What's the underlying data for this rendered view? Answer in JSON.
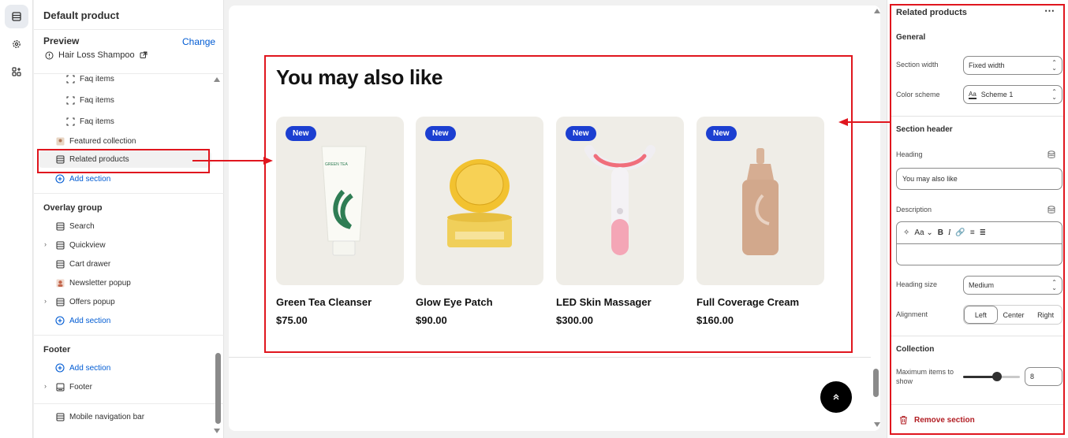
{
  "sidebar": {
    "title": "Default product",
    "preview_label": "Preview",
    "change_link": "Change",
    "preview_item": "Hair Loss Shampoo",
    "rows": [
      {
        "label": "Faq items"
      },
      {
        "label": "Faq items"
      },
      {
        "label": "Faq items"
      },
      {
        "label": "Featured collection"
      },
      {
        "label": "Related products"
      },
      {
        "label": "Add section"
      }
    ],
    "overlay_group": {
      "title": "Overlay group",
      "items": [
        {
          "label": "Search"
        },
        {
          "label": "Quickview"
        },
        {
          "label": "Cart drawer"
        },
        {
          "label": "Newsletter popup"
        },
        {
          "label": "Offers popup"
        },
        {
          "label": "Add section"
        }
      ]
    },
    "footer_group": {
      "title": "Footer",
      "items": [
        {
          "label": "Add section"
        },
        {
          "label": "Footer"
        }
      ]
    },
    "mobile_nav": "Mobile navigation bar"
  },
  "canvas": {
    "heading": "You may also like",
    "products": [
      {
        "badge": "New",
        "title": "Green Tea Cleanser",
        "price": "$75.00"
      },
      {
        "badge": "New",
        "title": "Glow Eye Patch",
        "price": "$90.00"
      },
      {
        "badge": "New",
        "title": "LED Skin Massager",
        "price": "$300.00"
      },
      {
        "badge": "New",
        "title": "Full Coverage Cream",
        "price": "$160.00"
      }
    ]
  },
  "panel": {
    "title": "Related products",
    "general": "General",
    "section_width_label": "Section width",
    "section_width_value": "Fixed width",
    "color_scheme_label": "Color scheme",
    "color_scheme_value": "Scheme 1",
    "color_scheme_swatch": "Aa",
    "section_header": "Section header",
    "heading_label": "Heading",
    "heading_value": "You may also like",
    "description_label": "Description",
    "rte_font": "Aa",
    "heading_size_label": "Heading size",
    "heading_size_value": "Medium",
    "alignment_label": "Alignment",
    "alignment_options": [
      "Left",
      "Center",
      "Right"
    ],
    "collection": "Collection",
    "max_items_label": "Maximum items to show",
    "max_items_value": 8,
    "max_items_range": [
      2,
      12
    ],
    "max_items_text": "8",
    "remove_section": "Remove section"
  },
  "colors": {
    "accent_blue": "#005bd3",
    "badge_blue": "#1c3fd1",
    "annotation_red": "#e0161e",
    "danger": "#b11c22"
  }
}
